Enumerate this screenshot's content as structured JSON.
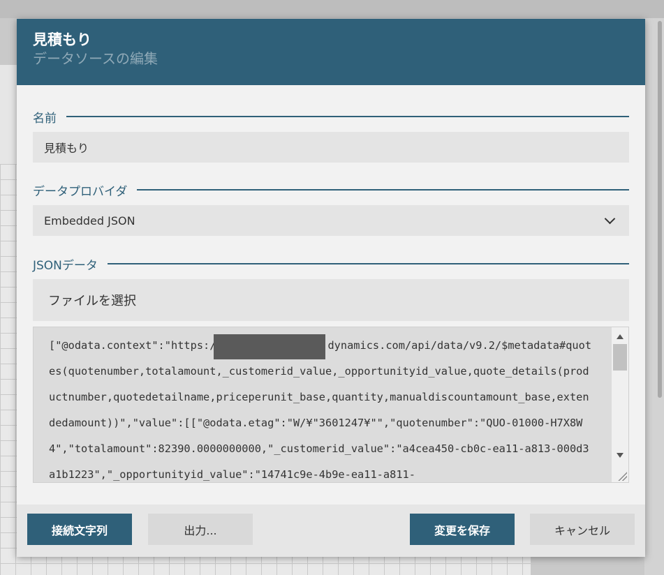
{
  "dialog": {
    "title": "見積もり",
    "subtitle": "データソースの編集"
  },
  "name_section": {
    "label": "名前",
    "value": "見積もり"
  },
  "provider_section": {
    "label": "データプロバイダ",
    "selected": "Embedded JSON"
  },
  "json_section": {
    "label": "JSONデータ",
    "file_button": "ファイルを選択",
    "content_before_redaction": "[\"@odata.context\":\"https:/",
    "content_after_redaction": "dynamics.com/api/data/v9.2/$metadata#quotes(quotenumber,totalamount,_customerid_value,_opportunityid_value,quote_details(productnumber,quotedetailname,priceperunit_base,quantity,manualdiscountamount_base,extendedamount))\",\"value\":[[\"@odata.etag\":\"W/¥\"3601247¥\"\",\"quotenumber\":\"QUO-01000-H7X8W4\",\"totalamount\":82390.0000000000,\"_customerid_value\":\"a4cea450-cb0c-ea11-a813-000d3a1b1223\",\"_opportunityid_value\":\"14741c9e-4b9e-ea11-a811-"
  },
  "footer": {
    "connection_string": "接続文字列",
    "export": "出力...",
    "save": "変更を保存",
    "cancel": "キャンセル"
  }
}
